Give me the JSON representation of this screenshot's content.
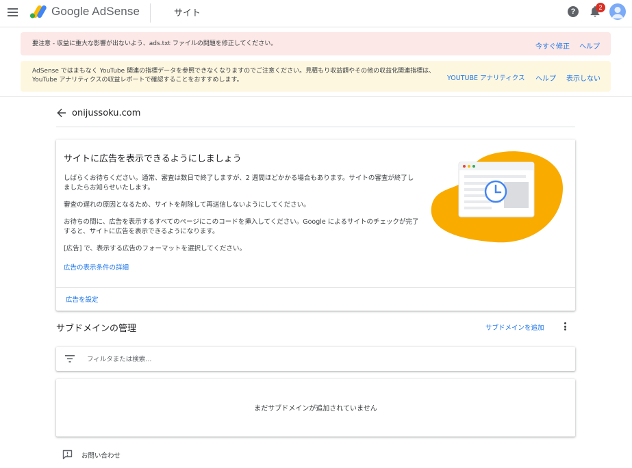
{
  "app": {
    "product_name": "Google AdSense",
    "section": "サイト",
    "notification_count": "2",
    "help_glyph": "?"
  },
  "alerts": {
    "ads_txt": {
      "text": "要注意 - 収益に重大な影響が出ないよう、ads.txt ファイルの問題を修正してください。",
      "fix_label": "今すぐ修正",
      "help_label": "ヘルプ"
    },
    "youtube": {
      "text": "AdSense ではまもなく YouTube 関連の指標データを参照できなくなりますのでご注意ください。見積もり収益額やその他の収益化関連指標は、YouTube アナリティクスの収益レポートで確認することをおすすめします。",
      "analytics_label": "YOUTUBE アナリティクス",
      "help_label": "ヘルプ",
      "dismiss_label": "表示しない"
    }
  },
  "site": {
    "name": "onijussoku.com"
  },
  "review_card": {
    "title": "サイトに広告を表示できるようにしましょう",
    "paragraphs": [
      "しばらくお待ちください。通常、審査は数日で終了しますが、2 週間ほどかかる場合もあります。サイトの審査が終了しましたらお知らせいたします。",
      "審査の遅れの原因となるため、サイトを削除して再送信しないようにしてください。",
      "お待ちの間に、広告を表示するすべてのページにこのコードを挿入してください。Google によるサイトのチェックが完了すると、サイトに広告を表示できるようになります。",
      "[広告] で、表示する広告のフォーマットを選択してください。"
    ],
    "details_link": "広告の表示条件の詳細",
    "action_label": "広告を設定"
  },
  "subdomains": {
    "title": "サブドメインの管理",
    "add_label": "サブドメインを追加",
    "filter_placeholder": "フィルタまたは検索...",
    "empty_text": "まだサブドメインが追加されていません"
  },
  "footer": {
    "contact_label": "お問い合わせ"
  },
  "colors": {
    "accent": "#1a73e8",
    "alert_red_bg": "#fce8e6",
    "alert_yellow_bg": "#fef7e0",
    "illustration_yellow": "#f9ab00",
    "badge_red": "#d93025"
  },
  "icons": [
    "menu-icon",
    "adsense-logo",
    "help-icon",
    "bell-icon",
    "avatar",
    "back-arrow-icon",
    "clock-icon",
    "more-vert-icon",
    "filter-icon",
    "feedback-icon"
  ]
}
